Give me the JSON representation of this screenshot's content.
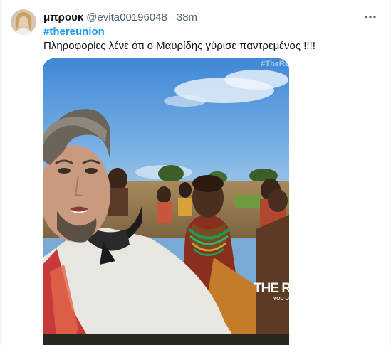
{
  "tweet": {
    "author_name": "μπρουκ",
    "handle": "@evita00196048",
    "separator": "·",
    "time": "38m",
    "hashtag": "#thereunion",
    "text": "Πληροφορίες λένε ότι ο Μαυρίδης γύρισε παντρεμένος !!!!"
  },
  "media": {
    "watermark_top": "#TheRe",
    "watermark_logo": "THE R",
    "watermark_sub": "YOU O"
  },
  "icons": {
    "more": "more-horizontal-icon",
    "avatar": "user-avatar"
  },
  "colors": {
    "link": "#1d9bf0",
    "secondary_text": "#536471",
    "primary_text": "#0f1419"
  }
}
